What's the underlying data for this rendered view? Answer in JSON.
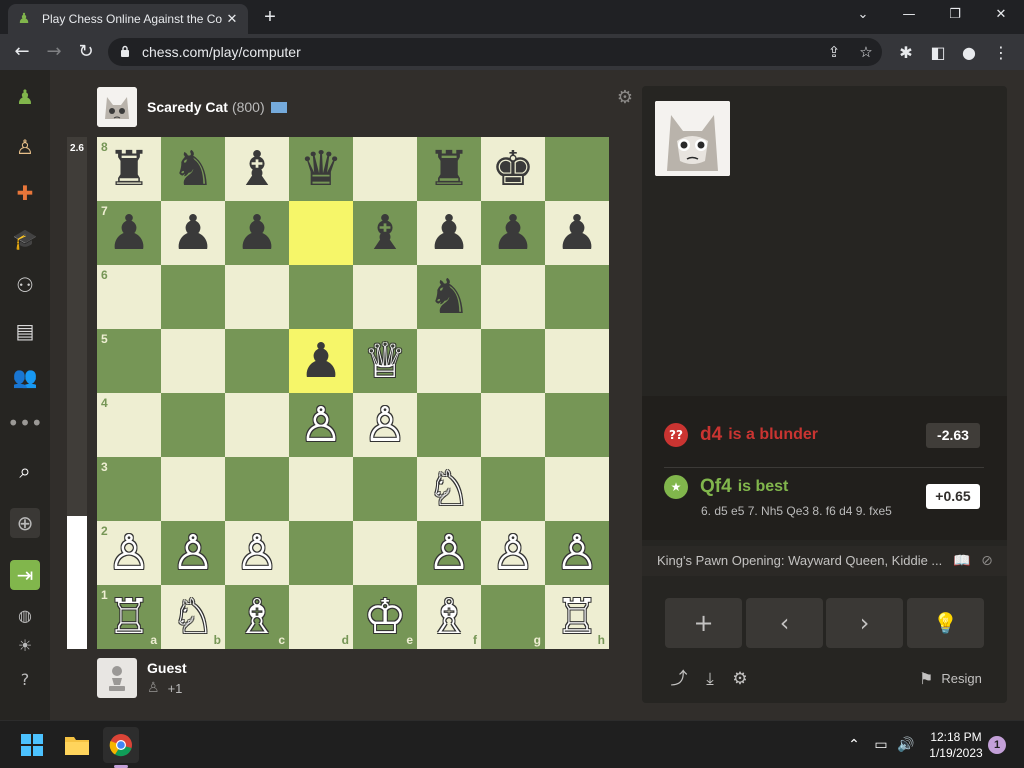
{
  "browser": {
    "tab_title": "Play Chess Online Against the Co",
    "url": "chess.com/play/computer"
  },
  "opponent": {
    "name": "Scaredy Cat",
    "rating": "(800)"
  },
  "player": {
    "name": "Guest",
    "score": "+1"
  },
  "eval_bar": {
    "label": "2.6",
    "white_fraction": 0.26
  },
  "board": {
    "ranks": [
      "8",
      "7",
      "6",
      "5",
      "4",
      "3",
      "2",
      "1"
    ],
    "files": [
      "a",
      "b",
      "c",
      "d",
      "e",
      "f",
      "g",
      "h"
    ],
    "rows": [
      [
        "♜",
        "♞",
        "♝",
        "♛",
        "",
        "♜",
        "♚",
        ""
      ],
      [
        "♟",
        "♟",
        "♟",
        "",
        "♝",
        "♟",
        "♟",
        "♟"
      ],
      [
        "",
        "",
        "",
        "",
        "",
        "♞",
        "",
        ""
      ],
      [
        "",
        "",
        "",
        "♟",
        "♕",
        "",
        "",
        ""
      ],
      [
        "",
        "",
        "",
        "♙",
        "♙",
        "",
        "",
        ""
      ],
      [
        "",
        "",
        "",
        "",
        "",
        "♘",
        "",
        ""
      ],
      [
        "♙",
        "♙",
        "♙",
        "",
        "",
        "♙",
        "♙",
        "♙"
      ],
      [
        "♖",
        "♘",
        "♗",
        "",
        "♔",
        "♗",
        "",
        "♖"
      ]
    ],
    "highlight": [
      "d7",
      "d5"
    ]
  },
  "analysis": {
    "blunder_badge": "??",
    "blunder_move": "d4",
    "blunder_text": "is a blunder",
    "blunder_eval": "-2.63",
    "best_badge": "★",
    "best_move": "Qf4",
    "best_text": "is best",
    "best_eval": "+0.65",
    "best_line": "6. d5 e5 7. Nh5 Qe3 8. f6 d4 9. fxe5"
  },
  "opening": "King's Pawn Opening: Wayward Queen, Kiddie ...",
  "controls": {
    "add": "+",
    "back": "‹",
    "forward": "›",
    "hint": "💡"
  },
  "resign_label": "Resign",
  "taskbar": {
    "time": "12:18 PM",
    "date": "1/19/2023",
    "notifications": "1"
  },
  "colors": {
    "light_square": "#eeeed2",
    "dark_square": "#769656",
    "highlight": "#f6f669",
    "blunder": "#ca3431",
    "best": "#81b64c"
  }
}
